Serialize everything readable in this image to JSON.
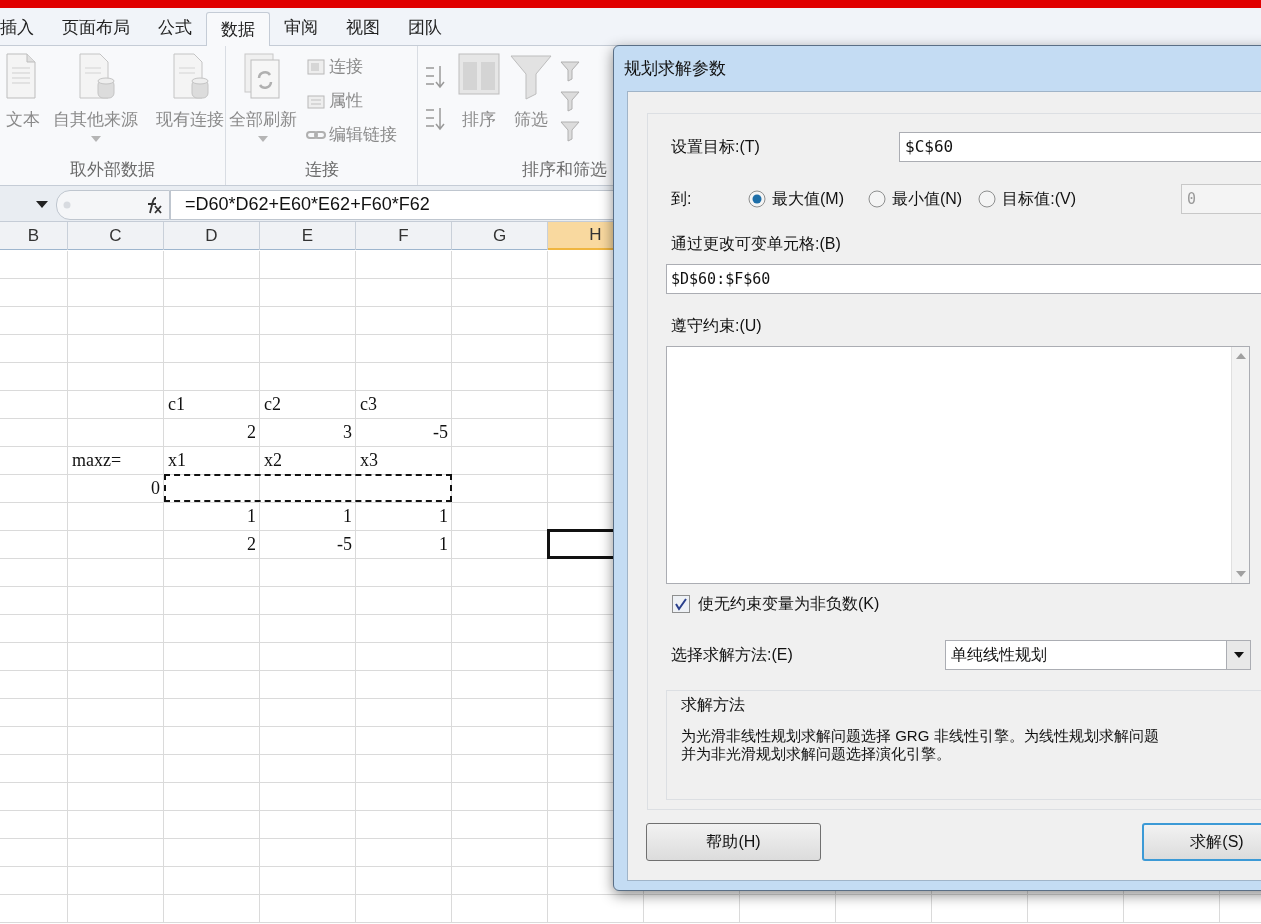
{
  "ribbon": {
    "tabs": [
      {
        "label": "插入",
        "selected": false
      },
      {
        "label": "页面布局",
        "selected": false
      },
      {
        "label": "公式",
        "selected": false
      },
      {
        "label": "数据",
        "selected": true
      },
      {
        "label": "审阅",
        "selected": false
      },
      {
        "label": "视图",
        "selected": false
      },
      {
        "label": "团队",
        "selected": false
      }
    ],
    "groups": [
      {
        "label": "取外部数据",
        "buttons": [
          {
            "label": "文本",
            "kind": "large"
          },
          {
            "label": "自其他来源",
            "kind": "large_dropdown"
          },
          {
            "label": "现有连接",
            "kind": "large"
          }
        ]
      },
      {
        "label": "连接",
        "buttons": [
          {
            "label": "全部刷新",
            "kind": "large_dropdown"
          },
          {
            "label": "连接",
            "kind": "small"
          },
          {
            "label": "属性",
            "kind": "small"
          },
          {
            "label": "编辑链接",
            "kind": "small"
          }
        ]
      },
      {
        "label": "排序和筛选",
        "buttons": [
          {
            "kind": "sort_pair"
          },
          {
            "label": "排序",
            "kind": "large"
          },
          {
            "label": "筛选",
            "kind": "large"
          },
          {
            "kind": "small_icons"
          }
        ]
      }
    ]
  },
  "formula_bar": {
    "formula": "=D60*D62+E60*E62+F60*F62"
  },
  "sheet": {
    "columns": [
      {
        "label": "B",
        "selected": false
      },
      {
        "label": "C",
        "selected": false
      },
      {
        "label": "D",
        "selected": false
      },
      {
        "label": "E",
        "selected": false
      },
      {
        "label": "F",
        "selected": false
      },
      {
        "label": "G",
        "selected": false
      },
      {
        "label": "H",
        "selected": true
      }
    ],
    "rows": [
      {
        "marquee": false,
        "cells": [
          null,
          null,
          {
            "text": "c1",
            "kind": "text",
            "selected": false
          },
          {
            "text": "c2",
            "kind": "text",
            "selected": false
          },
          {
            "text": "c3",
            "kind": "text",
            "selected": false
          },
          null,
          null
        ]
      },
      {
        "marquee": false,
        "cells": [
          null,
          null,
          {
            "text": "2",
            "kind": "number",
            "selected": false
          },
          {
            "text": "3",
            "kind": "number",
            "selected": false
          },
          {
            "text": "-5",
            "kind": "number",
            "selected": false
          },
          null,
          null
        ]
      },
      {
        "marquee": false,
        "cells": [
          null,
          {
            "text": "maxz=",
            "kind": "text",
            "selected": false
          },
          {
            "text": "x1",
            "kind": "text",
            "selected": false
          },
          {
            "text": "x2",
            "kind": "text",
            "selected": false
          },
          {
            "text": "x3",
            "kind": "text",
            "selected": false
          },
          null,
          null
        ]
      },
      {
        "marquee": true,
        "cells": [
          null,
          {
            "text": "0",
            "kind": "number",
            "selected": false
          },
          null,
          null,
          null,
          null,
          null
        ]
      },
      {
        "marquee": false,
        "cells": [
          null,
          null,
          {
            "text": "1",
            "kind": "number",
            "selected": false
          },
          {
            "text": "1",
            "kind": "number",
            "selected": false
          },
          {
            "text": "1",
            "kind": "number",
            "selected": false
          },
          null,
          null
        ]
      },
      {
        "marquee": false,
        "cells": [
          null,
          null,
          {
            "text": "2",
            "kind": "number",
            "selected": false
          },
          {
            "text": "-5",
            "kind": "number",
            "selected": false
          },
          {
            "text": "1",
            "kind": "number",
            "selected": false
          },
          null,
          {
            "kind": "empty",
            "selected": true
          }
        ]
      }
    ]
  },
  "dialog": {
    "title": "规划求解参数",
    "objective": {
      "label": "设置目标:(T)",
      "value": "$C$60"
    },
    "to": {
      "label": "到:",
      "options": [
        {
          "label": "最大值(M)",
          "selected": true
        },
        {
          "label": "最小值(N)",
          "selected": false
        },
        {
          "label": "目标值:(V)",
          "selected": false
        }
      ],
      "target_value": "0",
      "target_disabled": true
    },
    "variables": {
      "label": "通过更改可变单元格:(B)",
      "value": "$D$60:$F$60"
    },
    "constraints": {
      "label": "遵守约束:(U)"
    },
    "nonnegative": {
      "label": "使无约束变量为非负数(K)",
      "checked": true
    },
    "method": {
      "label": "选择求解方法:(E)",
      "value": "单纯线性规划"
    },
    "method_info": {
      "title": "求解方法",
      "lines": [
        "为光滑非线性规划求解问题选择 GRG 非线性引擎。为线性规划求解问题",
        "并为非光滑规划求解问题选择演化引擎。"
      ]
    },
    "buttons": [
      {
        "label": "帮助(H)",
        "kind": "default"
      },
      {
        "label": "求解(S)",
        "kind": "primary"
      }
    ]
  }
}
